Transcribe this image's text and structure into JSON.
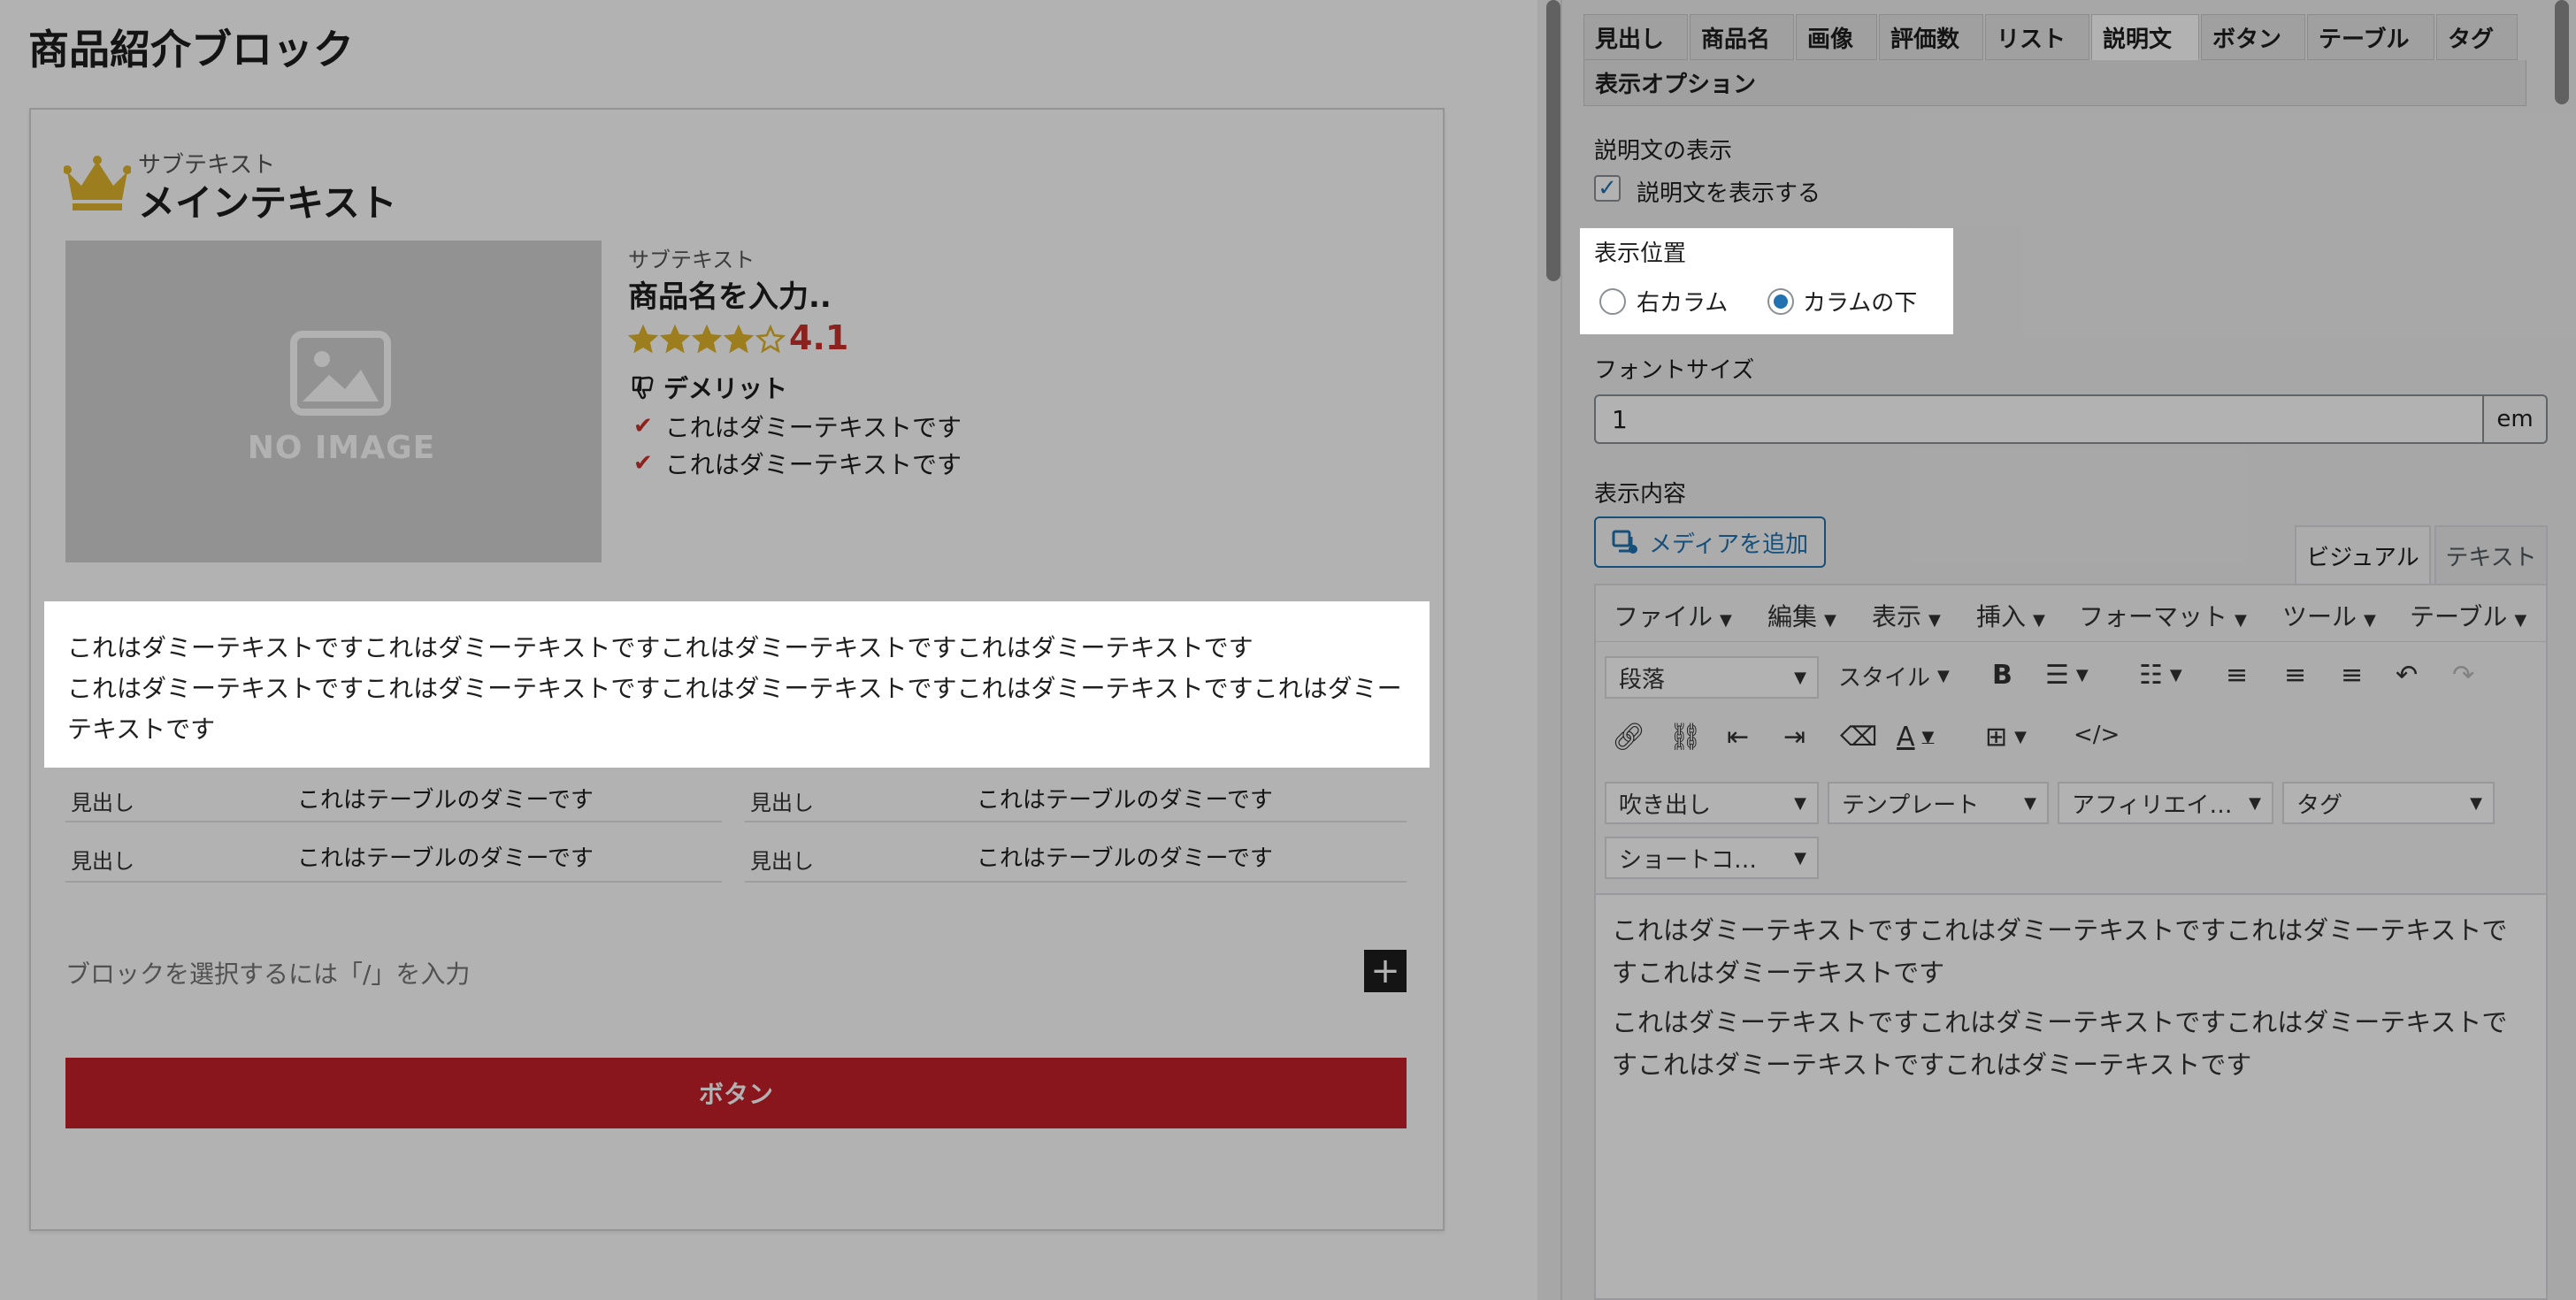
{
  "left": {
    "page_title": "商品紹介ブロック",
    "header": {
      "subtext": "サブテキスト",
      "main_text": "メインテキスト",
      "icon": "crown-icon"
    },
    "image_placeholder": {
      "label": "NO IMAGE",
      "icon": "image-placeholder-icon"
    },
    "product": {
      "subtext": "サブテキスト",
      "name": "商品名を入力..",
      "rating": 4.1,
      "rating_label": "4.1",
      "stars_filled": 4,
      "stars_total": 5
    },
    "demerit": {
      "title": "デメリット",
      "items": [
        "これはダミーテキストです",
        "これはダミーテキストです"
      ]
    },
    "description": {
      "line1": "これはダミーテキストですこれはダミーテキストですこれはダミーテキストですこれはダミーテキストです",
      "line2": "これはダミーテキストですこれはダミーテキストですこれはダミーテキストですこれはダミーテキストですこれはダミーテキストです"
    },
    "table": {
      "rows": [
        {
          "h1": "見出し",
          "v1": "これはテーブルのダミーです",
          "h2": "見出し",
          "v2": "これはテーブルのダミーです"
        },
        {
          "h1": "見出し",
          "v1": "これはテーブルのダミーです",
          "h2": "見出し",
          "v2": "これはテーブルのダミーです"
        }
      ]
    },
    "block_placeholder": "ブロックを選択するには「/」を入力",
    "button_label": "ボタン"
  },
  "right": {
    "tabs": [
      "見出し",
      "商品名",
      "画像",
      "評価数",
      "リスト",
      "説明文",
      "ボタン",
      "テーブル",
      "タグ",
      "表示オプション"
    ],
    "active_tab": "説明文",
    "display_section": {
      "label": "説明文の表示",
      "checkbox_label": "説明文を表示する",
      "checked": true
    },
    "position": {
      "label": "表示位置",
      "options": [
        "右カラム",
        "カラムの下"
      ],
      "selected": "カラムの下"
    },
    "font_size": {
      "label": "フォントサイズ",
      "value": "1",
      "unit": "em"
    },
    "content": {
      "label": "表示内容",
      "media_button": "メディアを追加",
      "editor_tabs": [
        "ビジュアル",
        "テキスト"
      ],
      "menus": [
        "ファイル",
        "編集",
        "表示",
        "挿入",
        "フォーマット",
        "ツール",
        "テーブル"
      ],
      "selects": {
        "paragraph": "段落",
        "style": "スタイル",
        "balloon": "吹き出し",
        "template": "テンプレート",
        "affiliate": "アフィリエイ…",
        "tag": "タグ",
        "shortcode": "ショートコ…"
      },
      "paragraphs": [
        "これはダミーテキストですこれはダミーテキストですこれはダミーテキストですこれはダミーテキストです",
        "これはダミーテキストですこれはダミーテキストですこれはダミーテキストですこれはダミーテキストですこれはダミーテキストです"
      ]
    }
  },
  "colors": {
    "accent_red": "#c4202a",
    "rating_red": "#c9322b",
    "star_gold": "#e0b52b",
    "wp_blue": "#2271b1"
  }
}
